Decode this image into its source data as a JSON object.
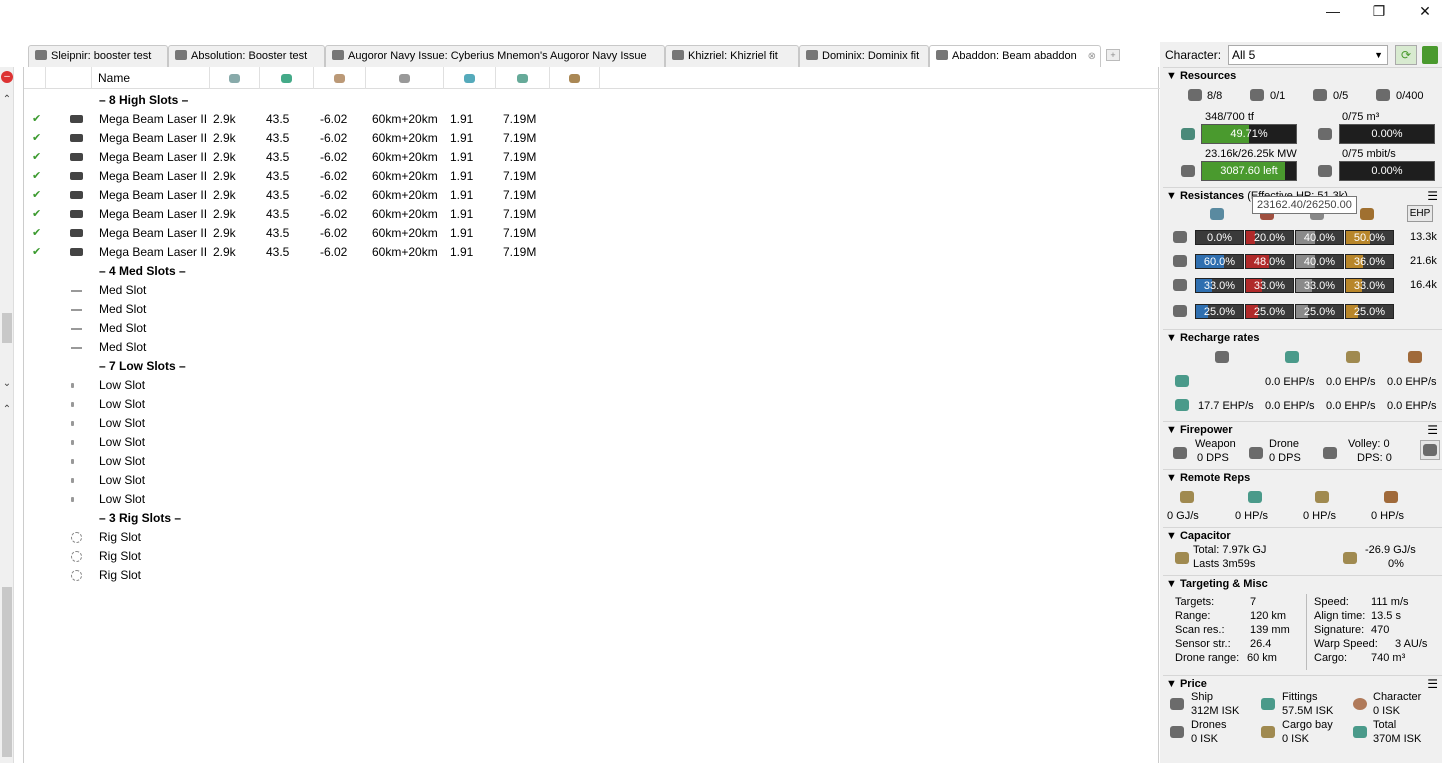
{
  "window": {
    "minimize": "—",
    "restore": "❐",
    "close": "✕"
  },
  "tabs": [
    {
      "label": "Sleipnir: booster test",
      "active": false
    },
    {
      "label": "Absolution: Booster test",
      "active": false
    },
    {
      "label": "Augoror Navy Issue: Cyberius Mnemon's Augoror Navy Issue",
      "active": false
    },
    {
      "label": "Khizriel: Khizriel fit",
      "active": false
    },
    {
      "label": "Dominix: Dominix fit",
      "active": false
    },
    {
      "label": "Abaddon: Beam abaddon",
      "active": true
    }
  ],
  "list": {
    "header": {
      "name": "Name"
    },
    "high_sep": "– 8 High Slots –",
    "med_sep": "– 4 Med Slots –",
    "low_sep": "– 7 Low Slots –",
    "rig_sep": "– 3 Rig Slots –",
    "modules": [
      {
        "name": "Mega Beam Laser II",
        "c1": "2.9k",
        "c2": "43.5",
        "c3": "-6.02",
        "range": "60km+20km",
        "c5": "1.91",
        "price": "7.19M"
      },
      {
        "name": "Mega Beam Laser II",
        "c1": "2.9k",
        "c2": "43.5",
        "c3": "-6.02",
        "range": "60km+20km",
        "c5": "1.91",
        "price": "7.19M"
      },
      {
        "name": "Mega Beam Laser II",
        "c1": "2.9k",
        "c2": "43.5",
        "c3": "-6.02",
        "range": "60km+20km",
        "c5": "1.91",
        "price": "7.19M"
      },
      {
        "name": "Mega Beam Laser II",
        "c1": "2.9k",
        "c2": "43.5",
        "c3": "-6.02",
        "range": "60km+20km",
        "c5": "1.91",
        "price": "7.19M"
      },
      {
        "name": "Mega Beam Laser II",
        "c1": "2.9k",
        "c2": "43.5",
        "c3": "-6.02",
        "range": "60km+20km",
        "c5": "1.91",
        "price": "7.19M"
      },
      {
        "name": "Mega Beam Laser II",
        "c1": "2.9k",
        "c2": "43.5",
        "c3": "-6.02",
        "range": "60km+20km",
        "c5": "1.91",
        "price": "7.19M"
      },
      {
        "name": "Mega Beam Laser II",
        "c1": "2.9k",
        "c2": "43.5",
        "c3": "-6.02",
        "range": "60km+20km",
        "c5": "1.91",
        "price": "7.19M"
      },
      {
        "name": "Mega Beam Laser II",
        "c1": "2.9k",
        "c2": "43.5",
        "c3": "-6.02",
        "range": "60km+20km",
        "c5": "1.91",
        "price": "7.19M"
      }
    ],
    "med_slots": [
      "Med Slot",
      "Med Slot",
      "Med Slot",
      "Med Slot"
    ],
    "low_slots": [
      "Low Slot",
      "Low Slot",
      "Low Slot",
      "Low Slot",
      "Low Slot",
      "Low Slot",
      "Low Slot"
    ],
    "rig_slots": [
      "Rig Slot",
      "Rig Slot",
      "Rig Slot"
    ]
  },
  "character": {
    "label": "Character:",
    "value": "All 5"
  },
  "resources": {
    "title": "Resources",
    "turrets": "8/8",
    "launchers": "0/1",
    "drones_active": "0/5",
    "drone_bay": "0/400",
    "cpu_text": "348/700 tf",
    "cpu_bar": "49.71%",
    "cpu_fraction": 0.4971,
    "drone_bay_volume": "0/75 m³",
    "drone_bay_bar": "0.00%",
    "power_text": "23.16k/26.25k MW",
    "power_bar": "3087.60 left",
    "power_fraction": 0.882,
    "bandwidth": "0/75 mbit/s",
    "bandwidth_bar": "0.00%"
  },
  "resistances": {
    "title": "Resistances",
    "subtitle": "(Effective HP: 51.3k)",
    "tooltip": "23162.40/26250.00",
    "ehp_button": "EHP",
    "rows": [
      {
        "em": "0.0%",
        "therm": "20.0%",
        "kin": "40.0%",
        "exp": "50.0%",
        "hp": "13.3k",
        "v": [
          0.0,
          0.2,
          0.4,
          0.5
        ]
      },
      {
        "em": "60.0%",
        "therm": "48.0%",
        "kin": "40.0%",
        "exp": "36.0%",
        "hp": "21.6k",
        "v": [
          0.6,
          0.48,
          0.4,
          0.36
        ]
      },
      {
        "em": "33.0%",
        "therm": "33.0%",
        "kin": "33.0%",
        "exp": "33.0%",
        "hp": "16.4k",
        "v": [
          0.33,
          0.33,
          0.33,
          0.33
        ]
      },
      {
        "em": "25.0%",
        "therm": "25.0%",
        "kin": "25.0%",
        "exp": "25.0%",
        "hp": "",
        "v": [
          0.25,
          0.25,
          0.25,
          0.25
        ]
      }
    ]
  },
  "recharge": {
    "title": "Recharge rates",
    "row1": [
      "0.0 EHP/s",
      "0.0 EHP/s",
      "0.0 EHP/s"
    ],
    "row2": [
      "17.7 EHP/s",
      "0.0 EHP/s",
      "0.0 EHP/s",
      "0.0 EHP/s"
    ]
  },
  "firepower": {
    "title": "Firepower",
    "weapon_label": "Weapon",
    "weapon_dps": "0 DPS",
    "drone_label": "Drone",
    "drone_dps": "0 DPS",
    "volley": "Volley: 0",
    "dps": "DPS: 0"
  },
  "remote_reps": {
    "title": "Remote Reps",
    "values": [
      "0 GJ/s",
      "0 HP/s",
      "0 HP/s",
      "0 HP/s"
    ]
  },
  "capacitor": {
    "title": "Capacitor",
    "total": "Total: 7.97k GJ",
    "lasts": "Lasts 3m59s",
    "delta": "-26.9 GJ/s",
    "percent": "0%"
  },
  "targeting": {
    "title": "Targeting & Misc",
    "left": [
      {
        "k": "Targets:",
        "v": "7"
      },
      {
        "k": "Range:",
        "v": "120 km"
      },
      {
        "k": "Scan res.:",
        "v": "139 mm"
      },
      {
        "k": "Sensor str.:",
        "v": "26.4"
      },
      {
        "k": "Drone range:",
        "v": "60 km"
      }
    ],
    "right": [
      {
        "k": "Speed:",
        "v": "111 m/s"
      },
      {
        "k": "Align time:",
        "v": "13.5 s"
      },
      {
        "k": "Signature:",
        "v": "470"
      },
      {
        "k": "Warp Speed:",
        "v": "3 AU/s"
      },
      {
        "k": "Cargo:",
        "v": "740 m³"
      }
    ]
  },
  "price": {
    "title": "Price",
    "ship_label": "Ship",
    "ship": "312M ISK",
    "fittings_label": "Fittings",
    "fittings": "57.5M ISK",
    "character_label": "Character",
    "character": "0 ISK",
    "drones_label": "Drones",
    "drones": "0 ISK",
    "cargo_label": "Cargo bay",
    "cargo": "0 ISK",
    "total_label": "Total",
    "total": "370M ISK"
  },
  "colors": {
    "em": "#2f6fb0",
    "therm": "#b02a2a",
    "kin": "#8a8a8a",
    "exp": "#b8862a",
    "green": "#4a9a2e"
  }
}
